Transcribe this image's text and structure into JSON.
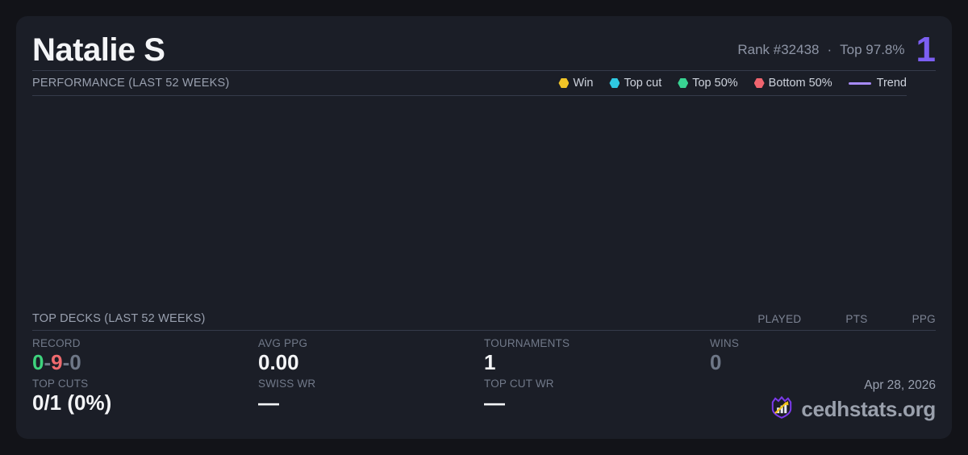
{
  "colors": {
    "card_background": "#1b1e27",
    "page_background": "#121318",
    "accent_purple": "#7c5ff2",
    "win_yellow": "#f0c427",
    "top_cut_cyan": "#2fc9e2",
    "top50_green": "#38d392",
    "bottom50_red": "#f0646e",
    "trend_lavender": "#a78bfa",
    "record_win_green": "#3ed37d",
    "record_loss_red": "#ef6a6e",
    "muted_gray": "#6e7787"
  },
  "header": {
    "player_name": "Natalie S",
    "rank": "Rank #32438",
    "dot_separator": "·",
    "top_percent": "Top 97.8%",
    "rating_number": "1"
  },
  "performance": {
    "title": "PERFORMANCE (LAST 52 WEEKS)",
    "legend": [
      {
        "label": "Win",
        "color": "#f0c427",
        "marker": "hex-dot"
      },
      {
        "label": "Top cut",
        "color": "#2fc9e2",
        "marker": "hex-dot"
      },
      {
        "label": "Top 50%",
        "color": "#38d392",
        "marker": "hex-dot"
      },
      {
        "label": "Bottom 50%",
        "color": "#f0646e",
        "marker": "hex-dot"
      },
      {
        "label": "Trend",
        "color": "#a78bfa",
        "marker": "line"
      }
    ]
  },
  "top_decks": {
    "title": "TOP DECKS (LAST 52 WEEKS)",
    "columns": [
      "PLAYED",
      "PTS",
      "PPG"
    ],
    "rows": []
  },
  "stats": {
    "record": {
      "label": "RECORD",
      "wins": "0",
      "losses": "9",
      "draws": "0",
      "separator": "-"
    },
    "avg_ppg": {
      "label": "AVG PPG",
      "value": "0.00"
    },
    "tournaments": {
      "label": "TOURNAMENTS",
      "value": "1"
    },
    "wins": {
      "label": "WINS",
      "value": "0"
    },
    "top_cuts": {
      "label": "TOP CUTS",
      "value": "0/1 (0%)"
    },
    "swiss_wr": {
      "label": "SWISS WR",
      "value": "—"
    },
    "top_cut_wr": {
      "label": "TOP CUT WR",
      "value": "—"
    }
  },
  "footer": {
    "date": "Apr 28, 2026",
    "brand": "cedhstats.org",
    "logo_icon": "crown-bar-chart-logo"
  }
}
